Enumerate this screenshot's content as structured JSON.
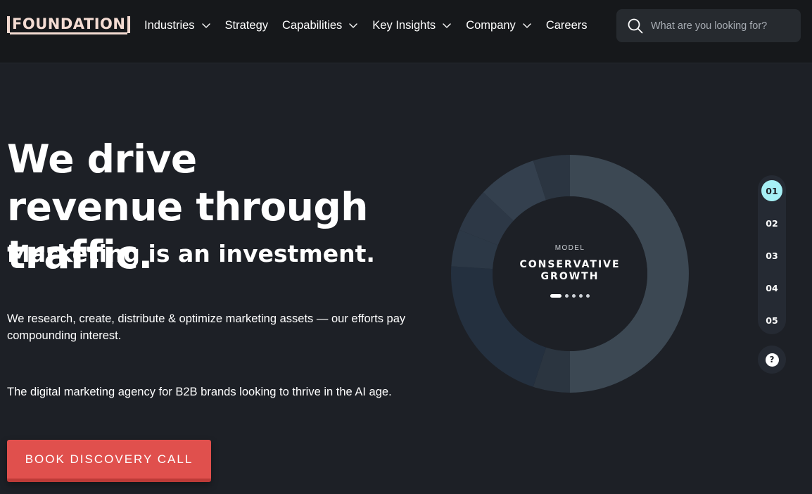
{
  "nav": {
    "logo": "FOUNDATION",
    "items": [
      {
        "label": "Industries",
        "has_dropdown": true
      },
      {
        "label": "Strategy",
        "has_dropdown": false
      },
      {
        "label": "Capabilities",
        "has_dropdown": true
      },
      {
        "label": "Key Insights",
        "has_dropdown": true
      },
      {
        "label": "Company",
        "has_dropdown": true
      },
      {
        "label": "Careers",
        "has_dropdown": false
      }
    ],
    "search_placeholder": "What are you looking for?",
    "search_icon": "search-icon",
    "dropdown_icon": "chevron-down-icon"
  },
  "hero": {
    "title": "We drive revenue through traffic.",
    "subtitle": "Marketing is an investment.",
    "paragraph_1": "We research, create, distribute & optimize marketing assets — our efforts pay compounding interest.",
    "paragraph_2": "The digital marketing agency for B2B brands looking to thrive in the AI age.",
    "cta_label": "BOOK DISCOVERY CALL"
  },
  "model": {
    "label": "MODEL",
    "name_line_1": "CONSERVATIVE",
    "name_line_2": "GROWTH",
    "active_dot": 0,
    "dot_count": 5,
    "segments": [
      {
        "share": 0.5,
        "color": "#3c4853"
      },
      {
        "share": 0.05,
        "color": "#2b3540"
      },
      {
        "share": 0.21,
        "color": "#24303f"
      },
      {
        "share": 0.05,
        "color": "#2c3846"
      },
      {
        "share": 0.06,
        "color": "#2d3846"
      },
      {
        "share": 0.08,
        "color": "#34404e"
      },
      {
        "share": 0.05,
        "color": "#2b3541"
      }
    ]
  },
  "stepper": {
    "steps": [
      "01",
      "02",
      "03",
      "04",
      "05"
    ],
    "active_index": 0,
    "help_label": "?"
  },
  "colors": {
    "page_bg": "#1d2026",
    "nav_bg": "#16181b",
    "accent_cta": "#e0504d",
    "logo": "#f4dcd3",
    "active_step": "#a6f0f5"
  }
}
